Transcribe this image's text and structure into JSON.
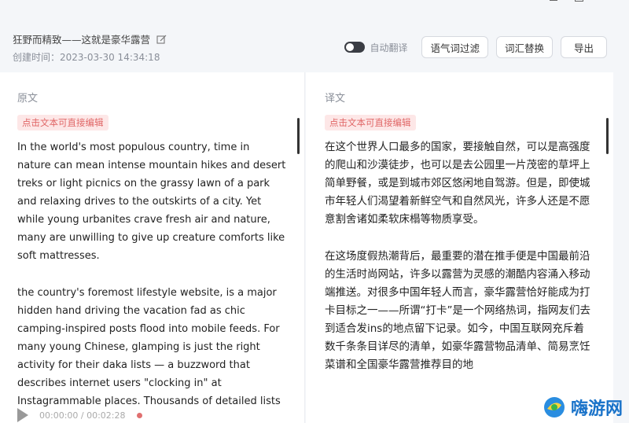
{
  "header": {
    "title": "狂野而精致——这就是豪华露营",
    "created": "创建时间：2023-03-30 14:34:18"
  },
  "toolbar": {
    "toggle_label": "自动翻译",
    "filter_button": "语气词过滤",
    "replace_button": "词汇替换",
    "export_button": "导出"
  },
  "left_panel": {
    "label": "原文",
    "hint": "点击文本可直接编辑",
    "paragraphs": [
      "In the world's most populous country, time in nature can mean intense mountain hikes and desert treks or light picnics on the grassy lawn of a park and relaxing drives to the outskirts of a city. Yet while young urbanites crave fresh air and nature, many are unwilling to give up creature comforts like soft mattresses.",
      "the country's foremost lifestyle website, is a major hidden hand driving the vacation fad as chic camping-inspired posts flood into mobile feeds. For many young Chinese, glamping is just the right activity for their daka lists — a buzzword that describes internet users \"clocking in\" at Instagrammable places. Thousands of detailed lists"
    ]
  },
  "right_panel": {
    "label": "译文",
    "hint": "点击文本可直接编辑",
    "paragraphs": [
      "在这个世界人口最多的国家，要接触自然，可以是高强度的爬山和沙漠徒步，也可以是去公园里一片茂密的草坪上简单野餐，或是到城市郊区悠闲地自驾游。但是，即使城市年轻人们渴望着新鲜空气和自然风光，许多人还是不愿意割舍诸如柔软床榻等物质享受。",
      "在这场度假热潮背后，最重要的潜在推手便是中国最前沿的生活时尚网站，许多以露营为灵感的潮酷内容涌入移动端推送。对很多中国年轻人而言，豪华露营恰好能成为打卡目标之一——所谓“打卡”是一个网络热词，指网友们去到适合发ins的地点留下记录。如今，中国互联网充斥着数千条条目详尽的清单，如豪华露营物品清单、简易烹饪菜谱和全国豪华露营推荐目的地"
    ]
  },
  "player": {
    "time": "00:00:00 / 00:02:28"
  },
  "watermark": {
    "text": "嗨游网"
  }
}
